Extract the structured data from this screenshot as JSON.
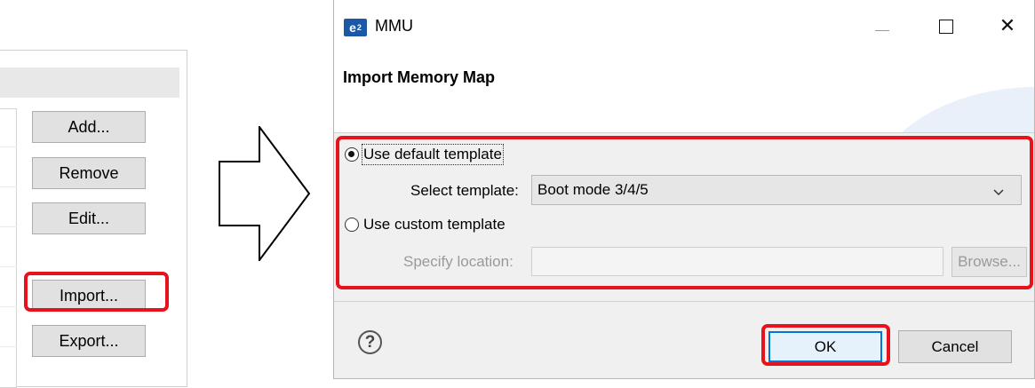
{
  "left_panel": {
    "buttons": {
      "add": "Add...",
      "remove": "Remove",
      "edit": "Edit...",
      "import": "Import...",
      "export": "Export..."
    }
  },
  "dialog": {
    "app_icon": "e",
    "app_icon_sup": "2",
    "title": "MMU",
    "window_controls": {
      "close": "✕"
    },
    "header": {
      "title": "Import Memory Map"
    },
    "default_template": {
      "label": "Use default template",
      "selected": true,
      "select_label": "Select template:",
      "select_value": "Boot mode 3/4/5"
    },
    "custom_template": {
      "label": "Use custom template",
      "selected": false,
      "location_label": "Specify location:",
      "location_value": "",
      "browse_label": "Browse..."
    },
    "help_glyph": "?",
    "ok_label": "OK",
    "cancel_label": "Cancel"
  },
  "colors": {
    "highlight": "#e8121c",
    "default_button_border": "#0078d7",
    "dialog_bg": "#f0f0f0"
  }
}
